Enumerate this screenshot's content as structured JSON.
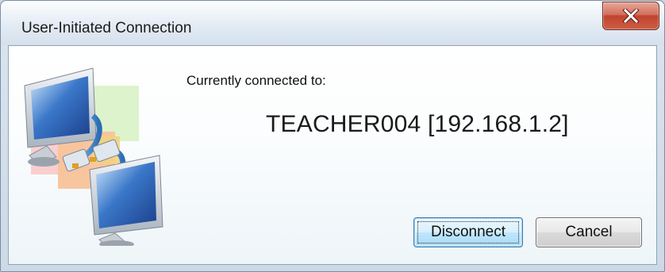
{
  "window": {
    "title": "User-Initiated Connection"
  },
  "dialog": {
    "connected_label": "Currently connected to:",
    "host": "TEACHER004 [192.168.1.2]"
  },
  "buttons": {
    "disconnect": "Disconnect",
    "cancel": "Cancel"
  },
  "icons": {
    "close": "close-icon",
    "network": "network-computers-icon"
  },
  "colors": {
    "close_button": "#c7503a",
    "default_button_border": "#3c7fb1"
  }
}
